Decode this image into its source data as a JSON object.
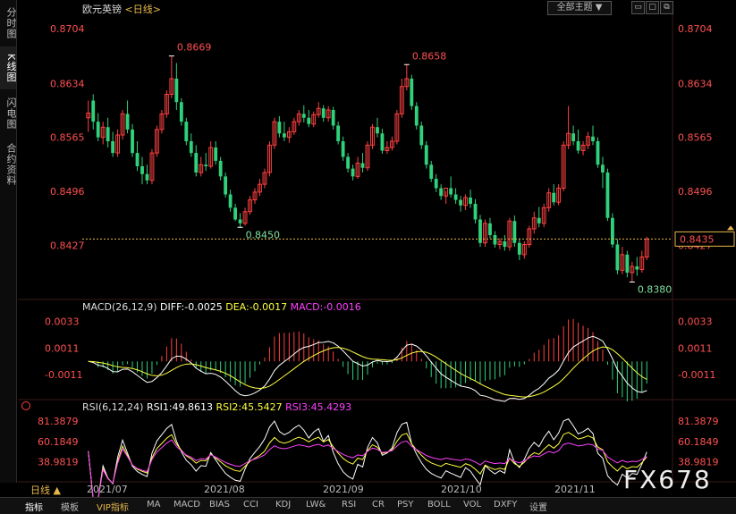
{
  "side_tabs": [
    {
      "label": "分时图",
      "active": false
    },
    {
      "label": "K线图",
      "active": true
    },
    {
      "label": "闪电图",
      "active": false
    },
    {
      "label": "合约资料",
      "active": false
    }
  ],
  "header": {
    "symbol": "欧元英镑",
    "period": "<日线>",
    "menu_label": "全部主题 ▼"
  },
  "bottom_tabs": [
    "指标",
    "模板",
    "VIP指标",
    "MA",
    "MACD",
    "BIAS",
    "CCI",
    "KDJ",
    "LW&",
    "RSI",
    "CR",
    "PSY",
    "BOLL",
    "VOL",
    "DXFY",
    "设置"
  ],
  "period_label": "日线 ▲",
  "watermark": "FX678",
  "colors": {
    "up": "#ff4040",
    "down": "#2fd17a",
    "macd_pos": "#ff4040",
    "macd_neg": "#2fd17a",
    "diff": "#ffffff",
    "dea": "#ffff40",
    "macd": "#ff40ff",
    "rsi1": "#ffffff",
    "rsi2": "#ffff40",
    "rsi3": "#ff40ff"
  },
  "chart_data": [
    {
      "type": "candlestick",
      "title": "欧元英镑 <日线>",
      "ylim": [
        0.836,
        0.872
      ],
      "y_ticks": [
        "0.8704",
        "0.8634",
        "0.8565",
        "0.8496",
        "0.8427"
      ],
      "x_tick_labels": [
        "2021/07",
        "2021/08",
        "2021/09",
        "2021/10",
        "2021/11"
      ],
      "last_price": "0.8435",
      "annotations": [
        {
          "label": "0.8669",
          "kind": "high"
        },
        {
          "label": "0.8658",
          "kind": "high"
        },
        {
          "label": "0.8450",
          "kind": "low"
        },
        {
          "label": "0.8380",
          "kind": "low"
        }
      ],
      "candles": [
        [
          0.859,
          0.8612,
          0.8596,
          0.8572
        ],
        [
          0.8612,
          0.862,
          0.8585,
          0.8575
        ],
        [
          0.8585,
          0.8596,
          0.8565,
          0.856
        ],
        [
          0.8565,
          0.8585,
          0.8578,
          0.8556
        ],
        [
          0.8578,
          0.859,
          0.856,
          0.8552
        ],
        [
          0.856,
          0.8572,
          0.8545,
          0.854
        ],
        [
          0.8545,
          0.8575,
          0.8568,
          0.854
        ],
        [
          0.8568,
          0.86,
          0.8595,
          0.8562
        ],
        [
          0.8595,
          0.8612,
          0.8575,
          0.857
        ],
        [
          0.8575,
          0.8582,
          0.8545,
          0.854
        ],
        [
          0.8545,
          0.856,
          0.8528,
          0.8522
        ],
        [
          0.8528,
          0.854,
          0.8518,
          0.8505
        ],
        [
          0.8518,
          0.853,
          0.851,
          0.8505
        ],
        [
          0.851,
          0.855,
          0.8545,
          0.8505
        ],
        [
          0.8545,
          0.858,
          0.8575,
          0.854
        ],
        [
          0.8575,
          0.86,
          0.8595,
          0.857
        ],
        [
          0.8595,
          0.8625,
          0.862,
          0.859
        ],
        [
          0.862,
          0.8669,
          0.864,
          0.8615
        ],
        [
          0.864,
          0.866,
          0.861,
          0.86
        ],
        [
          0.861,
          0.8615,
          0.8585,
          0.858
        ],
        [
          0.8585,
          0.859,
          0.856,
          0.8555
        ],
        [
          0.856,
          0.857,
          0.8545,
          0.854
        ],
        [
          0.8545,
          0.8555,
          0.852,
          0.8515
        ],
        [
          0.852,
          0.854,
          0.853,
          0.8515
        ],
        [
          0.853,
          0.8545,
          0.8528,
          0.8522
        ],
        [
          0.8528,
          0.856,
          0.8552,
          0.8525
        ],
        [
          0.8552,
          0.856,
          0.8535,
          0.853
        ],
        [
          0.8535,
          0.854,
          0.8515,
          0.851
        ],
        [
          0.8515,
          0.852,
          0.8492,
          0.8488
        ],
        [
          0.8492,
          0.8498,
          0.8475,
          0.847
        ],
        [
          0.8475,
          0.848,
          0.846,
          0.8458
        ],
        [
          0.846,
          0.8468,
          0.8455,
          0.845
        ],
        [
          0.8455,
          0.8475,
          0.847,
          0.8452
        ],
        [
          0.847,
          0.849,
          0.8485,
          0.8466
        ],
        [
          0.8485,
          0.85,
          0.8495,
          0.848
        ],
        [
          0.8495,
          0.8512,
          0.8505,
          0.849
        ],
        [
          0.8505,
          0.8525,
          0.852,
          0.85
        ],
        [
          0.852,
          0.856,
          0.8555,
          0.8515
        ],
        [
          0.8555,
          0.859,
          0.8585,
          0.855
        ],
        [
          0.8585,
          0.8592,
          0.857,
          0.8565
        ],
        [
          0.857,
          0.8585,
          0.8565,
          0.856
        ],
        [
          0.8565,
          0.8578,
          0.8572,
          0.8558
        ],
        [
          0.8572,
          0.859,
          0.8585,
          0.8568
        ],
        [
          0.8585,
          0.86,
          0.8595,
          0.858
        ],
        [
          0.8595,
          0.8606,
          0.859,
          0.8584
        ],
        [
          0.859,
          0.86,
          0.8582,
          0.8578
        ],
        [
          0.8582,
          0.8598,
          0.8594,
          0.8578
        ],
        [
          0.8594,
          0.861,
          0.8602,
          0.859
        ],
        [
          0.8602,
          0.8606,
          0.859,
          0.8585
        ],
        [
          0.859,
          0.8605,
          0.86,
          0.8585
        ],
        [
          0.86,
          0.8604,
          0.858,
          0.8575
        ],
        [
          0.858,
          0.8585,
          0.856,
          0.8556
        ],
        [
          0.856,
          0.8566,
          0.854,
          0.8535
        ],
        [
          0.854,
          0.8545,
          0.8525,
          0.852
        ],
        [
          0.8525,
          0.853,
          0.8515,
          0.851
        ],
        [
          0.8515,
          0.854,
          0.8532,
          0.8512
        ],
        [
          0.8532,
          0.8545,
          0.8526,
          0.852
        ],
        [
          0.8526,
          0.856,
          0.8555,
          0.8522
        ],
        [
          0.8555,
          0.8582,
          0.8578,
          0.855
        ],
        [
          0.8578,
          0.859,
          0.857,
          0.8565
        ],
        [
          0.857,
          0.8576,
          0.8548,
          0.8544
        ],
        [
          0.8548,
          0.856,
          0.8552,
          0.8544
        ],
        [
          0.8552,
          0.8566,
          0.856,
          0.8548
        ],
        [
          0.856,
          0.86,
          0.8595,
          0.8556
        ],
        [
          0.8595,
          0.864,
          0.863,
          0.859
        ],
        [
          0.863,
          0.8658,
          0.864,
          0.8625
        ],
        [
          0.864,
          0.8645,
          0.8605,
          0.86
        ],
        [
          0.8605,
          0.861,
          0.858,
          0.8575
        ],
        [
          0.858,
          0.8585,
          0.8555,
          0.855
        ],
        [
          0.8555,
          0.856,
          0.853,
          0.8525
        ],
        [
          0.853,
          0.8535,
          0.8512,
          0.8508
        ],
        [
          0.8512,
          0.8518,
          0.85,
          0.8495
        ],
        [
          0.85,
          0.8505,
          0.849,
          0.8485
        ],
        [
          0.849,
          0.8496,
          0.85,
          0.848
        ],
        [
          0.85,
          0.8515,
          0.8492,
          0.8488
        ],
        [
          0.8492,
          0.85,
          0.8485,
          0.848
        ],
        [
          0.8485,
          0.849,
          0.8478,
          0.847
        ],
        [
          0.8478,
          0.8492,
          0.8488,
          0.8472
        ],
        [
          0.8488,
          0.8498,
          0.848,
          0.8475
        ],
        [
          0.848,
          0.8486,
          0.846,
          0.8455
        ],
        [
          0.846,
          0.8466,
          0.843,
          0.8425
        ],
        [
          0.843,
          0.846,
          0.8455,
          0.8425
        ],
        [
          0.8455,
          0.8462,
          0.844,
          0.8436
        ],
        [
          0.844,
          0.8445,
          0.8428,
          0.8424
        ],
        [
          0.8428,
          0.8436,
          0.8432,
          0.8422
        ],
        [
          0.8432,
          0.844,
          0.8425,
          0.842
        ],
        [
          0.8425,
          0.8462,
          0.8458,
          0.842
        ],
        [
          0.8458,
          0.8465,
          0.843,
          0.8425
        ],
        [
          0.843,
          0.8436,
          0.8415,
          0.8408
        ],
        [
          0.8415,
          0.8432,
          0.8428,
          0.841
        ],
        [
          0.8428,
          0.8452,
          0.8448,
          0.8424
        ],
        [
          0.8448,
          0.847,
          0.8462,
          0.8442
        ],
        [
          0.8462,
          0.8476,
          0.8455,
          0.845
        ],
        [
          0.8455,
          0.848,
          0.8475,
          0.845
        ],
        [
          0.8475,
          0.85,
          0.8494,
          0.847
        ],
        [
          0.8494,
          0.8505,
          0.8482,
          0.8478
        ],
        [
          0.8482,
          0.8505,
          0.85,
          0.8478
        ],
        [
          0.85,
          0.856,
          0.8555,
          0.8496
        ],
        [
          0.8555,
          0.8605,
          0.857,
          0.855
        ],
        [
          0.857,
          0.858,
          0.856,
          0.8555
        ],
        [
          0.856,
          0.8575,
          0.8548,
          0.8544
        ],
        [
          0.8548,
          0.856,
          0.8555,
          0.8542
        ],
        [
          0.8555,
          0.8572,
          0.8566,
          0.855
        ],
        [
          0.8566,
          0.858,
          0.856,
          0.8555
        ],
        [
          0.856,
          0.8565,
          0.853,
          0.8526
        ],
        [
          0.853,
          0.854,
          0.852,
          0.85
        ],
        [
          0.852,
          0.8525,
          0.8462,
          0.8458
        ],
        [
          0.8462,
          0.8468,
          0.8428,
          0.8424
        ],
        [
          0.8428,
          0.8435,
          0.8395,
          0.839
        ],
        [
          0.8395,
          0.8425,
          0.8415,
          0.839
        ],
        [
          0.8415,
          0.842,
          0.8392,
          0.8386
        ],
        [
          0.8392,
          0.8406,
          0.84,
          0.838
        ],
        [
          0.84,
          0.8412,
          0.8396,
          0.8388
        ],
        [
          0.8396,
          0.842,
          0.8412,
          0.8392
        ],
        [
          0.8412,
          0.8438,
          0.8435,
          0.8408
        ]
      ]
    },
    {
      "type": "bar+line",
      "title": "MACD(26,12,9)",
      "values_text": {
        "diff": "DIFF:-0.0025",
        "dea": "DEA:-0.0017",
        "macd": "MACD:-0.0016"
      },
      "y_ticks": [
        "0.0033",
        "0.0011",
        "-0.0011"
      ]
    },
    {
      "type": "line",
      "title": "RSI(6,12,24)",
      "values_text": {
        "rsi1": "RSI1:49.8613",
        "rsi2": "RSI2:45.5427",
        "rsi3": "RSI3:45.4293"
      },
      "y_ticks": [
        "81.3879",
        "60.1849",
        "38.9819"
      ]
    }
  ]
}
